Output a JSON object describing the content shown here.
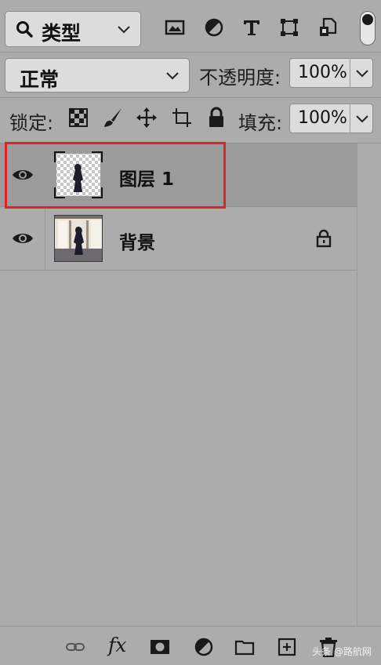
{
  "filter": {
    "type_label": "类型"
  },
  "blend": {
    "mode": "正常"
  },
  "opacity": {
    "label": "不透明度:",
    "value": "100%"
  },
  "lock": {
    "label": "锁定:"
  },
  "fill": {
    "label": "填充:",
    "value": "100%"
  },
  "layers": [
    {
      "name": "图层 1",
      "selected": true,
      "locked": false
    },
    {
      "name": "背景",
      "selected": false,
      "locked": true
    }
  ],
  "watermark": "头条 @路航网",
  "colors": {
    "panel": "#acacac",
    "selected_row": "#9b9b9b",
    "highlight": "#e02424"
  }
}
